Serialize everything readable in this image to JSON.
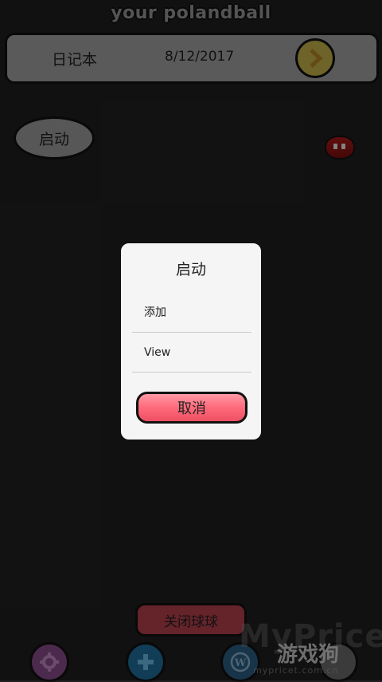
{
  "app_title": "your polandball",
  "top_bar": {
    "notebook_label": "日记本",
    "date": "8/12/2017",
    "next_icon": "chevron-right-icon"
  },
  "start_bubble": {
    "label": "启动"
  },
  "dialog": {
    "title": "启动",
    "options": [
      "添加",
      "View"
    ],
    "cancel_label": "取消"
  },
  "bottom": {
    "close_ball_label": "关闭球球",
    "icons": [
      "gear-icon",
      "plus-icon",
      "wordpress-icon"
    ]
  },
  "watermark": {
    "main": "MyPrice",
    "sub": "游戏狗",
    "url": "mypricet.com.cn"
  },
  "colors": {
    "background": "#202020",
    "cancel_button": "#ff6e7f",
    "next_button": "#c9b44a",
    "ball": "#b21a1a"
  }
}
